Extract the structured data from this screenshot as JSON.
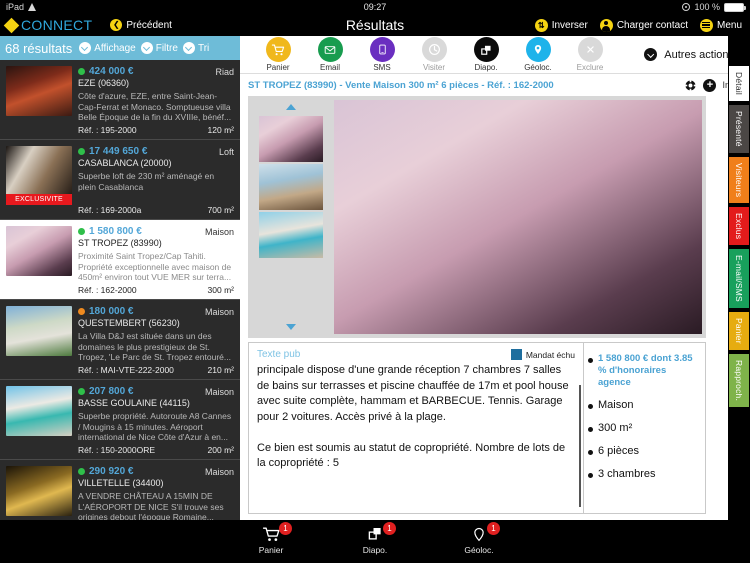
{
  "status_bar": {
    "device": "iPad",
    "wifi_icon": "wifi-icon",
    "time": "09:27",
    "battery_pct": "100 %",
    "location_icon": "location-icon"
  },
  "app_bar": {
    "brand": "CONNECT",
    "brand_icon": "diamond-logo-icon",
    "back_label": "Précédent",
    "back_icon": "chevron-left-icon",
    "title": "Résultats",
    "actions": [
      {
        "label": "Inverser",
        "icon": "swap-icon"
      },
      {
        "label": "Charger contact",
        "icon": "person-icon"
      },
      {
        "label": "Menu",
        "icon": "hamburger-icon"
      }
    ]
  },
  "left_panel": {
    "filter_bar": {
      "results_count": "68 résultats",
      "items": [
        {
          "label": "Affichage",
          "icon": "chevron-down-icon"
        },
        {
          "label": "Filtre",
          "icon": "chevron-down-icon"
        },
        {
          "label": "Tri",
          "icon": "chevron-down-icon"
        }
      ]
    },
    "results": [
      {
        "price": "424 000 €",
        "dot_color": "#2fbf4a",
        "type": "Riad",
        "city": "EZE (06360)",
        "description": "Côte d'azure, EZE, entre Saint-Jean-Cap-Ferrat et Monaco. Somptueuse villa Belle Époque de la fin du XVIIIe, bénéf...",
        "ref": "Réf. : 195-2000",
        "surface": "120 m²",
        "exclusive": "",
        "selected": false,
        "photo": "villa-night-red"
      },
      {
        "price": "17 449 650 €",
        "dot_color": "#2fbf4a",
        "type": "Loft",
        "city": "CASABLANCA (20000)",
        "description": "Superbe loft de 230 m² aménagé en plein Casablanca",
        "ref": "Réf. : 169-2000a",
        "surface": "700 m²",
        "exclusive": "EXCLUSIVITE",
        "selected": false,
        "photo": "loft-interior"
      },
      {
        "price": "1 580 800 €",
        "dot_color": "#2fbf4a",
        "type": "Maison",
        "city": "ST TROPEZ (83990)",
        "description": "Proximité Saint Tropez/Cap Tahiti. Propriété exceptionnelle avec maison de 450m² environ tout VUE MER sur terra...",
        "ref": "Réf. : 162-2000",
        "surface": "300 m²",
        "exclusive": "",
        "selected": true,
        "photo": "terrace-sunset"
      },
      {
        "price": "180 000 €",
        "dot_color": "#ef8a1f",
        "type": "Maison",
        "city": "QUESTEMBERT (56230)",
        "description": "La Villa D&J est située dans un des domaines le plus prestigieux de St. Tropez, 'Le Parc de St. Tropez entouré...",
        "ref": "Réf. : MAI-VTE-222-2000",
        "surface": "210 m²",
        "exclusive": "",
        "selected": false,
        "photo": "mansion-garden"
      },
      {
        "price": "207 800 €",
        "dot_color": "#2fbf4a",
        "type": "Maison",
        "city": "BASSE GOULAINE (44115)",
        "description": "Superbe propriété. Autoroute A8 Cannes / Mougins à 15 minutes. Aéroport international de Nice Côte d'Azur à en...",
        "ref": "Réf. : 150-2000ORE",
        "surface": "200 m²",
        "exclusive": "",
        "selected": false,
        "photo": "pool-white-house"
      },
      {
        "price": "290 920 €",
        "dot_color": "#2fbf4a",
        "type": "Maison",
        "city": "VILLETELLE (34400)",
        "description": "A VENDRE CHÂTEAU A 15MIN DE L'AÉROPORT DE NICE S'il trouve ses origines debout l'époque Romaine...",
        "ref": "",
        "surface": "",
        "exclusive": "",
        "selected": false,
        "photo": "chateau-night"
      }
    ]
  },
  "detail_toolbar": {
    "buttons": [
      {
        "label": "Panier",
        "icon": "cart-icon",
        "color": "#f0b81c",
        "dim": false
      },
      {
        "label": "Email",
        "icon": "envelope-icon",
        "color": "#189c4f",
        "dim": false
      },
      {
        "label": "SMS",
        "icon": "phone-icon",
        "color": "#6a2ec0",
        "dim": false
      },
      {
        "label": "Visiter",
        "icon": "clock-icon",
        "color": "#d9d9d9",
        "dim": true
      },
      {
        "label": "Diapo.",
        "icon": "slides-icon",
        "color": "#0b0b0b",
        "dim": false
      },
      {
        "label": "Géoloc.",
        "icon": "pin-icon",
        "color": "#1eb3ea",
        "dim": false
      },
      {
        "label": "Exclure",
        "icon": "close-icon",
        "color": "#d9d9d9",
        "dim": true
      }
    ],
    "more_label": "Autres actions",
    "more_icon": "chevron-down-icon"
  },
  "detail": {
    "title": "ST TROPEZ (83990) - Vente Maison 300 m² 6 pièces - Réf. : 162-2000",
    "fullscreen_icon": "crosshair-icon",
    "infos_icon": "plus-circle-icon",
    "infos_label": "Infos",
    "gallery": {
      "up_icon": "arrow-up-icon",
      "down_icon": "arrow-down-icon",
      "thumbnails": [
        "terrace-sunset",
        "terrace-sea-view",
        "villa-pool-day"
      ],
      "main_photo": "terrace-sunset"
    },
    "text_panel": {
      "title": "Texte pub",
      "mandat_label": "Mandat échu",
      "mandat_color": "#1e6e9e",
      "body": "principale dispose d'une grande réception 7 chambres 7 salles de bains sur terrasses et piscine chauffée de 17m et pool house avec suite complète, hammam et BARBECUE. Tennis. Garage pour 2 voitures. Accès privé à la plage.\n\nCe bien est soumis au statut de copropriété. Nombre de lots de la copropriété : 5"
    },
    "facts": [
      {
        "text": "1 580 800 € dont 3.85 % d'honoraires agence",
        "highlight": true
      },
      {
        "text": "Maison",
        "highlight": false
      },
      {
        "text": "300 m²",
        "highlight": false
      },
      {
        "text": "6 pièces",
        "highlight": false
      },
      {
        "text": "3 chambres",
        "highlight": false
      }
    ]
  },
  "vertical_tabs": [
    {
      "label": "Détail",
      "bg": "#ffffff",
      "fg": "#333333",
      "active": true
    },
    {
      "label": "Présenté",
      "bg": "#4b4745",
      "fg": "#ffffff",
      "active": false
    },
    {
      "label": "Visiteurs",
      "bg": "#f07f1a",
      "fg": "#ffffff",
      "active": false
    },
    {
      "label": "Exclus",
      "bg": "#e31b1b",
      "fg": "#ffffff",
      "active": false
    },
    {
      "label": "E-mail/SMS",
      "bg": "#18a05c",
      "fg": "#ffffff",
      "active": false
    },
    {
      "label": "Panier",
      "bg": "#e6ac10",
      "fg": "#ffffff",
      "active": false
    },
    {
      "label": "Rapproch.",
      "bg": "#7fb34a",
      "fg": "#ffffff",
      "active": false
    }
  ],
  "bottom_bar": [
    {
      "label": "Panier",
      "icon": "cart-icon",
      "badge": "1"
    },
    {
      "label": "Diapo.",
      "icon": "slides-icon",
      "badge": "1"
    },
    {
      "label": "Géoloc.",
      "icon": "pin-icon",
      "badge": "1"
    }
  ]
}
